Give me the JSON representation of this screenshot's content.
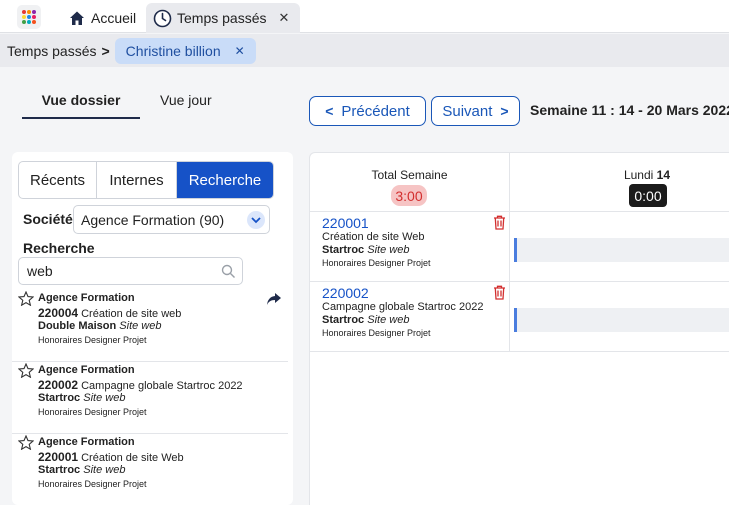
{
  "tabs": {
    "home_label": "Accueil",
    "time_label": "Temps passés",
    "close_symbol": "✕"
  },
  "breadcrumb": {
    "root": "Temps passés",
    "separator": ">",
    "chip": "Christine billion",
    "chip_close": "✕"
  },
  "view_tabs": {
    "dossier": "Vue dossier",
    "jour": "Vue jour"
  },
  "week_nav": {
    "prev_label": "Précédent",
    "next_label": "Suivant",
    "week_label": "Semaine 11 : 14 - 20 Mars 2022"
  },
  "left_panel": {
    "segments": [
      "Récents",
      "Internes",
      "Recherche"
    ],
    "societe_label": "Société",
    "societe_value": "Agence Formation (90)",
    "recherche_label": "Recherche",
    "search_value": "web",
    "results": [
      {
        "client": "Agence Formation",
        "code": "220004",
        "title": "Création de site web",
        "company": "Double Maison",
        "category": "Site web",
        "libelle": "Honoraires Designer Projet"
      },
      {
        "client": "Agence Formation",
        "code": "220002",
        "title": "Campagne globale Startroc 2022",
        "company": "Startroc",
        "category": "Site web",
        "libelle": "Honoraires Designer Projet"
      },
      {
        "client": "Agence Formation",
        "code": "220001",
        "title": "Création de site Web",
        "company": "Startroc",
        "category": "Site web",
        "libelle": "Honoraires Designer Projet"
      }
    ]
  },
  "grid": {
    "total_label": "Total Semaine",
    "total_value": "3:00",
    "day_label": "Lundi",
    "day_number": "14",
    "day_value": "0:00",
    "rows": [
      {
        "code": "220001",
        "title": "Création de site Web",
        "company": "Startroc",
        "category": "Site web",
        "libelle": "Honoraires Designer Projet"
      },
      {
        "code": "220002",
        "title": "Campagne globale Startroc 2022",
        "company": "Startroc",
        "category": "Site web",
        "libelle": "Honoraires Designer Projet"
      }
    ]
  },
  "colors": {
    "accent": "#1652c7",
    "chip_bg": "#c9dcf8",
    "total_badge_bg": "#f6c4c4",
    "danger": "#d32f2f"
  }
}
